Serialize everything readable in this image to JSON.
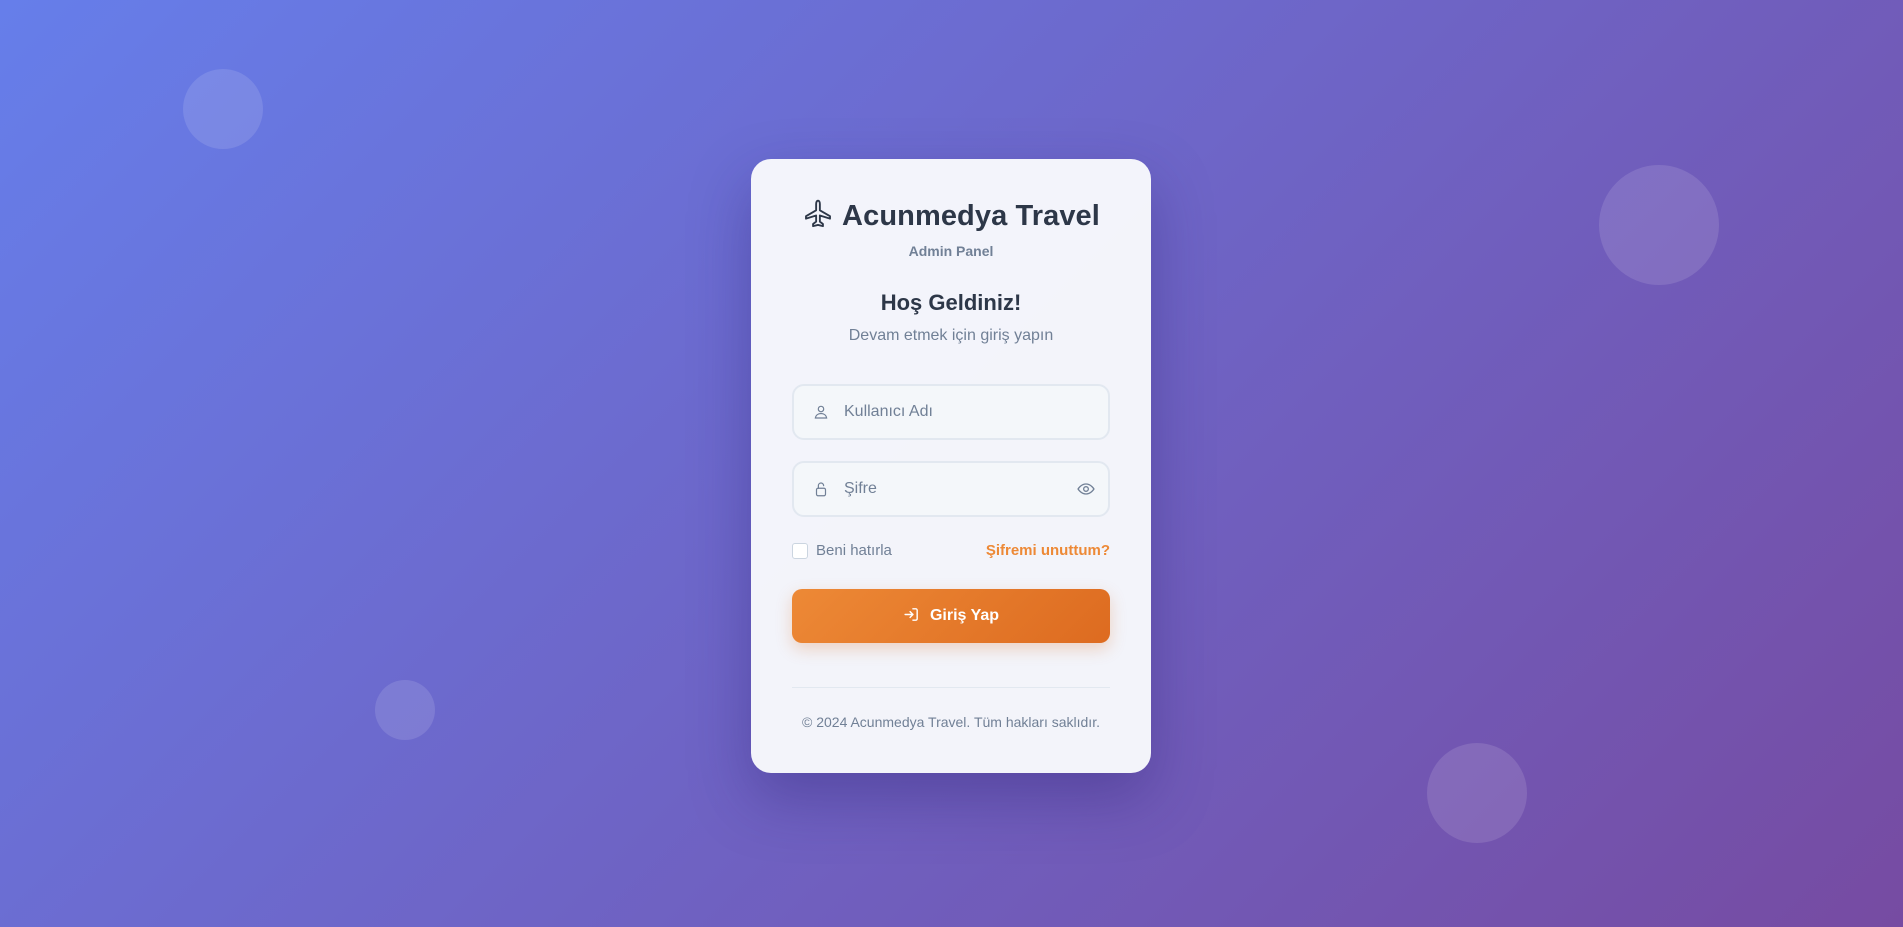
{
  "brand": {
    "icon": "airplane-icon",
    "title": "Acunmedya Travel",
    "subtitle": "Admin Panel"
  },
  "welcome": {
    "title": "Hoş Geldiniz!",
    "subtitle": "Devam etmek için giriş yapın"
  },
  "form": {
    "username": {
      "icon": "user-icon",
      "placeholder": "Kullanıcı Adı",
      "value": ""
    },
    "password": {
      "icon": "lock-icon",
      "placeholder": "Şifre",
      "value": "",
      "toggle_icon": "eye-icon"
    },
    "remember_label": "Beni hatırla",
    "remember_checked": false,
    "forgot_label": "Şifremi unuttum?",
    "submit_label": "Giriş Yap",
    "submit_icon": "sign-in-icon"
  },
  "footer": {
    "copyright": "© 2024 Acunmedya Travel. Tüm hakları saklıdır."
  },
  "colors": {
    "background_gradient": [
      "#667eea",
      "#764ba2"
    ],
    "accent": "#ed8936",
    "accent_dark": "#dd6b20",
    "text_dark": "#2d3748",
    "text_muted": "#718096",
    "card_bg": "#f8f9fc"
  }
}
